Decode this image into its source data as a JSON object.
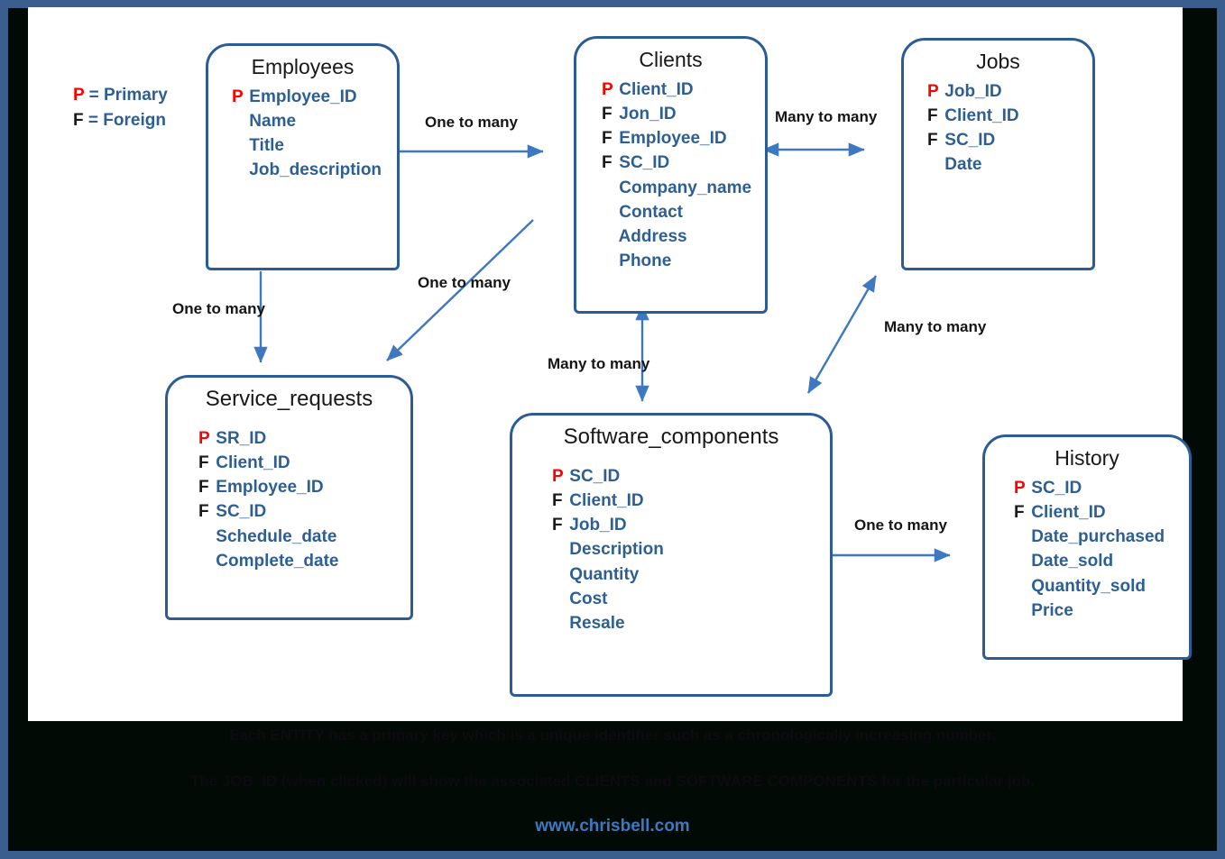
{
  "legend": {
    "primary": {
      "key": "P",
      "sep": " = ",
      "label": "Primary"
    },
    "foreign": {
      "key": "F",
      "sep": " = ",
      "label": "Foreign"
    }
  },
  "colors": {
    "frame_border": "#3a5f8f",
    "backdrop": "#010a04",
    "canvas": "#ffffff",
    "entity_border": "#2b5c96",
    "attribute_text": "#2e5f93",
    "primary_key": "#ff0000",
    "foreign_key": "#1a1a1a",
    "arrow": "#3d78c0",
    "url_text": "#3d78c0"
  },
  "entities": [
    {
      "id": "employees",
      "title": "Employees",
      "attributes": [
        {
          "key": "P",
          "name": "Employee_ID"
        },
        {
          "key": "",
          "name": "Name"
        },
        {
          "key": "",
          "name": "Title"
        },
        {
          "key": "",
          "name": "Job_description"
        }
      ]
    },
    {
      "id": "clients",
      "title": "Clients",
      "attributes": [
        {
          "key": "P",
          "name": "Client_ID"
        },
        {
          "key": "F",
          "name": "Jon_ID"
        },
        {
          "key": "F",
          "name": "Employee_ID"
        },
        {
          "key": "F",
          "name": "SC_ID"
        },
        {
          "key": "",
          "name": "Company_name"
        },
        {
          "key": "",
          "name": "Contact"
        },
        {
          "key": "",
          "name": "Address"
        },
        {
          "key": "",
          "name": "Phone"
        }
      ]
    },
    {
      "id": "jobs",
      "title": "Jobs",
      "attributes": [
        {
          "key": "P",
          "name": "Job_ID"
        },
        {
          "key": "F",
          "name": "Client_ID"
        },
        {
          "key": "F",
          "name": "SC_ID"
        },
        {
          "key": "",
          "name": "Date"
        }
      ]
    },
    {
      "id": "service_requests",
      "title": "Service_requests",
      "attributes": [
        {
          "key": "P",
          "name": "SR_ID"
        },
        {
          "key": "F",
          "name": "Client_ID"
        },
        {
          "key": "F",
          "name": "Employee_ID"
        },
        {
          "key": "F",
          "name": "SC_ID"
        },
        {
          "key": "",
          "name": "Schedule_date"
        },
        {
          "key": "",
          "name": "Complete_date"
        }
      ]
    },
    {
      "id": "software_components",
      "title": "Software_components",
      "attributes": [
        {
          "key": "P",
          "name": "SC_ID"
        },
        {
          "key": "F",
          "name": "Client_ID"
        },
        {
          "key": "F",
          "name": "Job_ID"
        },
        {
          "key": "",
          "name": "Description"
        },
        {
          "key": "",
          "name": "Quantity"
        },
        {
          "key": "",
          "name": "Cost"
        },
        {
          "key": "",
          "name": "Resale"
        }
      ]
    },
    {
      "id": "history",
      "title": "History",
      "attributes": [
        {
          "key": "P",
          "name": "SC_ID"
        },
        {
          "key": "F",
          "name": "Client_ID"
        },
        {
          "key": "",
          "name": "Date_purchased"
        },
        {
          "key": "",
          "name": "Date_sold"
        },
        {
          "key": "",
          "name": "Quantity_sold"
        },
        {
          "key": "",
          "name": "Price"
        }
      ]
    }
  ],
  "relationships": [
    {
      "id": "emp-cli",
      "from": "employees",
      "to": "clients",
      "label": "One to many",
      "arrow": "single"
    },
    {
      "id": "cli-job",
      "from": "clients",
      "to": "jobs",
      "label": "Many to many",
      "arrow": "double"
    },
    {
      "id": "emp-sr",
      "from": "employees",
      "to": "service_requests",
      "label": "One to many",
      "arrow": "single"
    },
    {
      "id": "cli-sr",
      "from": "clients",
      "to": "service_requests",
      "label": "One to many",
      "arrow": "single"
    },
    {
      "id": "cli-sc",
      "from": "clients",
      "to": "software_components",
      "label": "Many to many",
      "arrow": "double"
    },
    {
      "id": "job-sc",
      "from": "jobs",
      "to": "software_components",
      "label": "Many to many",
      "arrow": "double"
    },
    {
      "id": "sc-hist",
      "from": "software_components",
      "to": "history",
      "label": "One to many",
      "arrow": "single"
    }
  ],
  "notes": {
    "line1": "Each ENTITY has a primary key which is a unique identifier such as a chronologically increasing number.",
    "line2": "The JOB_ID (when clicked) will show the associated CLIENTS and SOFTWARE COMPONENTS for the particular job."
  },
  "footer": {
    "url": "www.chrisbell.com"
  }
}
